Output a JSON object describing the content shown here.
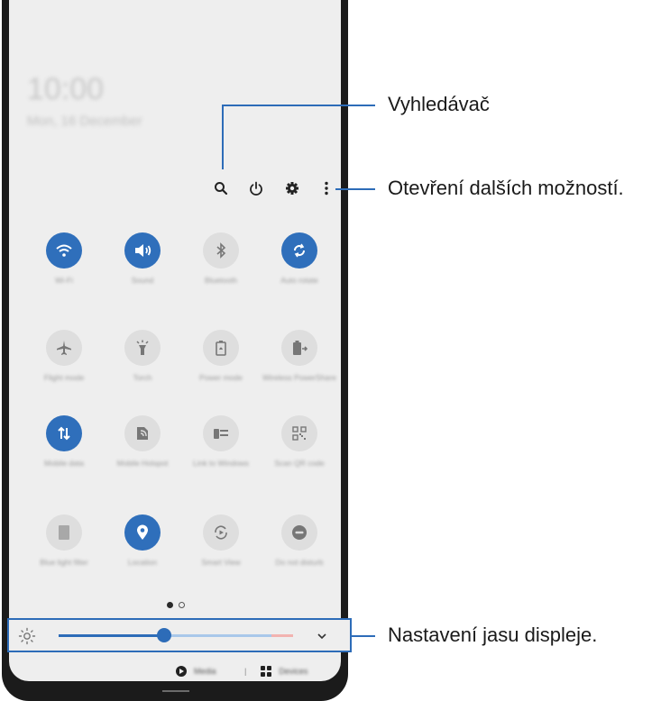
{
  "lockscreen": {
    "time": "10:00",
    "date": "Mon, 16 December"
  },
  "tiles": [
    {
      "label": "Wi-Fi",
      "icon": "wifi-icon",
      "on": true
    },
    {
      "label": "Sound",
      "icon": "volume-icon",
      "on": true
    },
    {
      "label": "Bluetooth",
      "icon": "bluetooth-icon",
      "on": false
    },
    {
      "label": "Auto rotate",
      "icon": "auto-rotate-icon",
      "on": true
    },
    {
      "label": "Flight mode",
      "icon": "airplane-icon",
      "on": false
    },
    {
      "label": "Torch",
      "icon": "torch-icon",
      "on": false
    },
    {
      "label": "Power mode",
      "icon": "battery-icon",
      "on": false
    },
    {
      "label": "Wireless PowerShare",
      "icon": "powershare-icon",
      "on": false
    },
    {
      "label": "Mobile data",
      "icon": "mobile-data-icon",
      "on": true
    },
    {
      "label": "Mobile Hotspot",
      "icon": "hotspot-icon",
      "on": false
    },
    {
      "label": "Link to Windows",
      "icon": "link-windows-icon",
      "on": false
    },
    {
      "label": "Scan QR code",
      "icon": "qr-icon",
      "on": false
    },
    {
      "label": "Blue light filter",
      "icon": "blue-light-icon",
      "on": false
    },
    {
      "label": "Location",
      "icon": "location-icon",
      "on": true
    },
    {
      "label": "Smart View",
      "icon": "smart-view-icon",
      "on": false
    },
    {
      "label": "Do not disturb",
      "icon": "dnd-icon",
      "on": false
    }
  ],
  "page_dots": {
    "active": 0,
    "count": 2
  },
  "brightness": {
    "level": 0.45
  },
  "bottom_bar": {
    "media": "Media",
    "devices": "Devices"
  },
  "callouts": {
    "search": "Vyhledávač",
    "more_options": "Otevření dalších možností.",
    "brightness": "Nastavení jasu displeje."
  },
  "colors": {
    "accent": "#2d6cb8",
    "tile_on": "#2f6fbb",
    "tile_off": "#dedede"
  }
}
